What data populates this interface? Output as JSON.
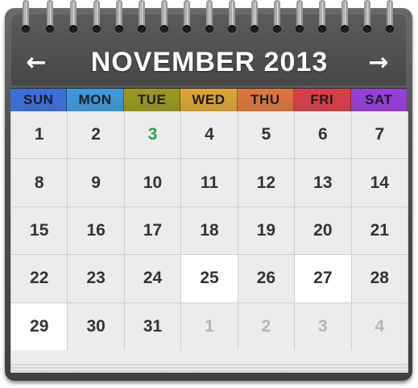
{
  "calendar": {
    "month_year": "NOVEMBER 2013",
    "prev_arrow": "←",
    "next_arrow": "→",
    "weekdays": [
      {
        "label": "SUN",
        "color": "#3a6fe0"
      },
      {
        "label": "MON",
        "color": "#3c9be0"
      },
      {
        "label": "TUE",
        "color": "#9a9a1c"
      },
      {
        "label": "WED",
        "color": "#e0a830"
      },
      {
        "label": "THU",
        "color": "#e0773a"
      },
      {
        "label": "FRI",
        "color": "#e03c45"
      },
      {
        "label": "SAT",
        "color": "#9a3ce0"
      }
    ],
    "days": [
      {
        "label": "1",
        "state": "normal"
      },
      {
        "label": "2",
        "state": "normal"
      },
      {
        "label": "3",
        "state": "today"
      },
      {
        "label": "4",
        "state": "normal"
      },
      {
        "label": "5",
        "state": "normal"
      },
      {
        "label": "6",
        "state": "normal"
      },
      {
        "label": "7",
        "state": "normal"
      },
      {
        "label": "8",
        "state": "normal"
      },
      {
        "label": "9",
        "state": "normal"
      },
      {
        "label": "10",
        "state": "normal"
      },
      {
        "label": "11",
        "state": "normal"
      },
      {
        "label": "12",
        "state": "normal"
      },
      {
        "label": "13",
        "state": "normal"
      },
      {
        "label": "14",
        "state": "normal"
      },
      {
        "label": "15",
        "state": "normal"
      },
      {
        "label": "16",
        "state": "normal"
      },
      {
        "label": "17",
        "state": "normal"
      },
      {
        "label": "18",
        "state": "normal"
      },
      {
        "label": "19",
        "state": "normal"
      },
      {
        "label": "20",
        "state": "normal"
      },
      {
        "label": "21",
        "state": "normal"
      },
      {
        "label": "22",
        "state": "normal"
      },
      {
        "label": "23",
        "state": "normal"
      },
      {
        "label": "24",
        "state": "normal"
      },
      {
        "label": "25",
        "state": "highlight"
      },
      {
        "label": "26",
        "state": "normal"
      },
      {
        "label": "27",
        "state": "highlight"
      },
      {
        "label": "28",
        "state": "normal"
      },
      {
        "label": "29",
        "state": "highlight"
      },
      {
        "label": "30",
        "state": "normal"
      },
      {
        "label": "31",
        "state": "normal"
      },
      {
        "label": "1",
        "state": "other"
      },
      {
        "label": "2",
        "state": "other"
      },
      {
        "label": "3",
        "state": "other"
      },
      {
        "label": "4",
        "state": "other"
      }
    ],
    "colors": {
      "today": "#2ea043",
      "frame": "#4d4d4d",
      "cell": "#ececec",
      "highlight_cell": "#ffffff",
      "other_month_text": "#b5b5b5"
    }
  }
}
